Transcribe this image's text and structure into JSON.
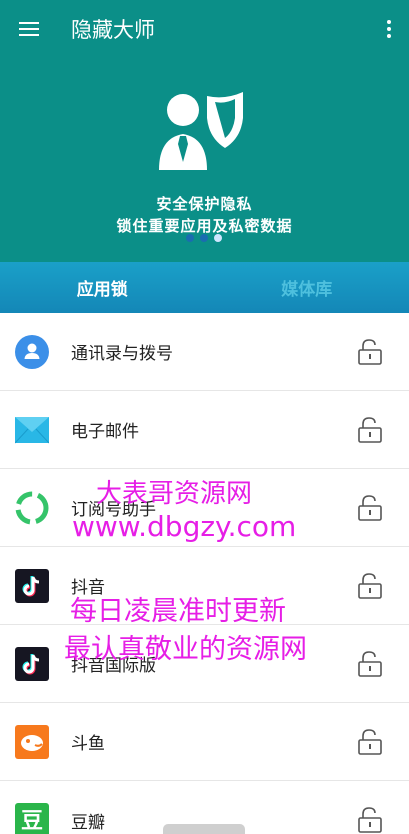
{
  "header": {
    "title": "隐藏大师",
    "menu_icon": "menu-icon",
    "more_icon": "more-vert-icon"
  },
  "banner": {
    "line1": "安全保护隐私",
    "line2": "锁住重要应用及私密数据",
    "page_count": 3,
    "active_page": 3
  },
  "tabs": [
    {
      "label": "应用锁",
      "active": true
    },
    {
      "label": "媒体库",
      "active": false
    }
  ],
  "apps": [
    {
      "name": "通讯录与拨号",
      "icon": "contacts-icon",
      "locked": false
    },
    {
      "name": "电子邮件",
      "icon": "email-icon",
      "locked": false
    },
    {
      "name": "订阅号助手",
      "icon": "subscription-assistant-icon",
      "locked": false
    },
    {
      "name": "抖音",
      "icon": "douyin-icon",
      "locked": false
    },
    {
      "name": "抖音国际版",
      "icon": "tiktok-icon",
      "locked": false
    },
    {
      "name": "斗鱼",
      "icon": "douyu-icon",
      "locked": false
    },
    {
      "name": "豆瓣",
      "icon": "douban-icon",
      "locked": false
    }
  ],
  "watermark": {
    "line1": "大表哥资源网",
    "line2": "www.dbgzy.com",
    "line3": "每日凌晨准时更新",
    "line4": "最认真敬业的资源网"
  },
  "colors": {
    "primary": "#0b8f88",
    "tab_bar": "#1487b7",
    "watermark": "#e61ee6"
  }
}
